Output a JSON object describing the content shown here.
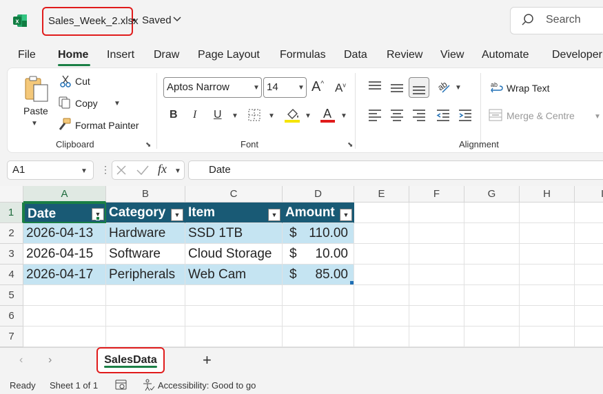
{
  "titlebar": {
    "filename": "Sales_Week_2.xlsx",
    "separator": "•",
    "save_status": "Saved",
    "search_placeholder": "Search"
  },
  "menu_tabs": [
    "File",
    "Home",
    "Insert",
    "Draw",
    "Page Layout",
    "Formulas",
    "Data",
    "Review",
    "View",
    "Automate",
    "Developer"
  ],
  "active_tab": "Home",
  "ribbon": {
    "clipboard": {
      "paste": "Paste",
      "cut": "Cut",
      "copy": "Copy",
      "format_painter": "Format Painter",
      "label": "Clipboard"
    },
    "font": {
      "font_name": "Aptos Narrow",
      "font_size": "14",
      "bold": "B",
      "italic": "I",
      "underline": "U",
      "label": "Font",
      "highlight_color": "#f5e400",
      "font_color": "#e01b1b"
    },
    "alignment": {
      "wrap_text": "Wrap Text",
      "merge_centre": "Merge & Centre",
      "label": "Alignment"
    }
  },
  "formula_bar": {
    "name_box": "A1",
    "fx": "fx",
    "formula": "Date"
  },
  "sheet": {
    "columns": [
      "A",
      "B",
      "C",
      "D",
      "E",
      "F",
      "G",
      "H",
      "I"
    ],
    "rows": [
      "1",
      "2",
      "3",
      "4",
      "5",
      "6",
      "7"
    ],
    "table_headers": [
      "Date",
      "Category",
      "Item",
      "Amount"
    ],
    "table_rows": [
      {
        "date": "2026-04-13",
        "category": "Hardware",
        "item": "SSD 1TB",
        "currency": "$",
        "amount": "110.00"
      },
      {
        "date": "2026-04-15",
        "category": "Software",
        "item": "Cloud Storage",
        "currency": "$",
        "amount": "10.00"
      },
      {
        "date": "2026-04-17",
        "category": "Peripherals",
        "item": "Web Cam",
        "currency": "$",
        "amount": "85.00"
      }
    ]
  },
  "sheet_tabs": {
    "active": "SalesData",
    "add": "+"
  },
  "status_bar": {
    "ready": "Ready",
    "sheet_position": "Sheet 1 of 1",
    "accessibility": "Accessibility: Good to go"
  },
  "colors": {
    "accent": "#1a7f45",
    "table_header": "#195a75",
    "table_band": "#c5e4f2",
    "highlight_border": "#e01b1b"
  }
}
